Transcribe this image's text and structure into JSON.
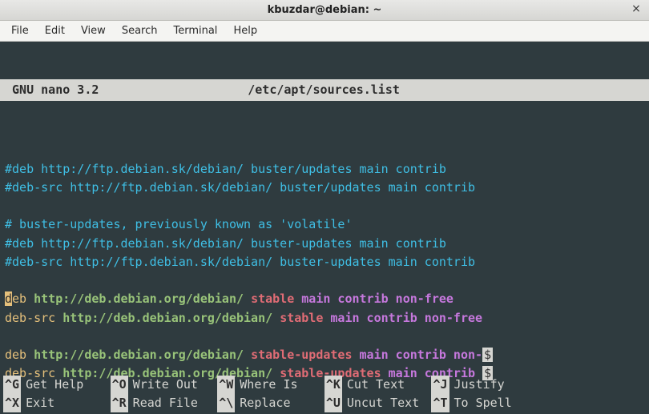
{
  "window": {
    "title": "kbuzdar@debian: ~",
    "close_glyph": "×"
  },
  "menubar": {
    "items": [
      "File",
      "Edit",
      "View",
      "Search",
      "Terminal",
      "Help"
    ]
  },
  "nano": {
    "app": " GNU nano 3.2",
    "filename": "/etc/apt/sources.list"
  },
  "editor_lines": [
    {
      "segments": []
    },
    {
      "segments": [
        {
          "text": "#deb http://ftp.debian.sk/debian/ buster/updates main contrib",
          "cls": "c-comment"
        }
      ]
    },
    {
      "segments": [
        {
          "text": "#deb-src http://ftp.debian.sk/debian/ buster/updates main contrib",
          "cls": "c-comment"
        }
      ]
    },
    {
      "segments": []
    },
    {
      "segments": [
        {
          "text": "# buster-updates, previously known as 'volatile'",
          "cls": "c-comment"
        }
      ]
    },
    {
      "segments": [
        {
          "text": "#deb http://ftp.debian.sk/debian/ buster-updates main contrib",
          "cls": "c-comment"
        }
      ]
    },
    {
      "segments": [
        {
          "text": "#deb-src http://ftp.debian.sk/debian/ buster-updates main contrib",
          "cls": "c-comment"
        }
      ]
    },
    {
      "segments": []
    },
    {
      "segments": [
        {
          "text": "d",
          "cls": "cursor"
        },
        {
          "text": "eb ",
          "cls": "c-yellow"
        },
        {
          "text": "http://deb.debian.org/debian/ ",
          "cls": "c-green"
        },
        {
          "text": "stable ",
          "cls": "c-red"
        },
        {
          "text": "main contrib non-free",
          "cls": "c-magenta"
        }
      ]
    },
    {
      "segments": [
        {
          "text": "deb-src ",
          "cls": "c-yellow"
        },
        {
          "text": "http://deb.debian.org/debian/ ",
          "cls": "c-green"
        },
        {
          "text": "stable ",
          "cls": "c-red"
        },
        {
          "text": "main contrib non-free",
          "cls": "c-magenta"
        }
      ]
    },
    {
      "segments": []
    },
    {
      "segments": [
        {
          "text": "deb ",
          "cls": "c-yellow"
        },
        {
          "text": "http://deb.debian.org/debian/ ",
          "cls": "c-green"
        },
        {
          "text": "stable-updates ",
          "cls": "c-red"
        },
        {
          "text": "main contrib non-",
          "cls": "c-magenta"
        },
        {
          "text": "$",
          "cls": "trunc"
        }
      ]
    },
    {
      "segments": [
        {
          "text": "deb-src ",
          "cls": "c-yellow"
        },
        {
          "text": "http://deb.debian.org/debian/ ",
          "cls": "c-green"
        },
        {
          "text": "stable-updates ",
          "cls": "c-red"
        },
        {
          "text": "main contrib ",
          "cls": "c-magenta"
        },
        {
          "text": "$",
          "cls": "trunc"
        }
      ]
    }
  ],
  "shortcuts": {
    "rows": [
      [
        {
          "key": "^G",
          "desc": "Get Help"
        },
        {
          "key": "^O",
          "desc": "Write Out"
        },
        {
          "key": "^W",
          "desc": "Where Is"
        },
        {
          "key": "^K",
          "desc": "Cut Text"
        },
        {
          "key": "^J",
          "desc": "Justify"
        }
      ],
      [
        {
          "key": "^X",
          "desc": "Exit"
        },
        {
          "key": "^R",
          "desc": "Read File"
        },
        {
          "key": "^\\",
          "desc": "Replace"
        },
        {
          "key": "^U",
          "desc": "Uncut Text"
        },
        {
          "key": "^T",
          "desc": "To Spell"
        }
      ]
    ]
  }
}
